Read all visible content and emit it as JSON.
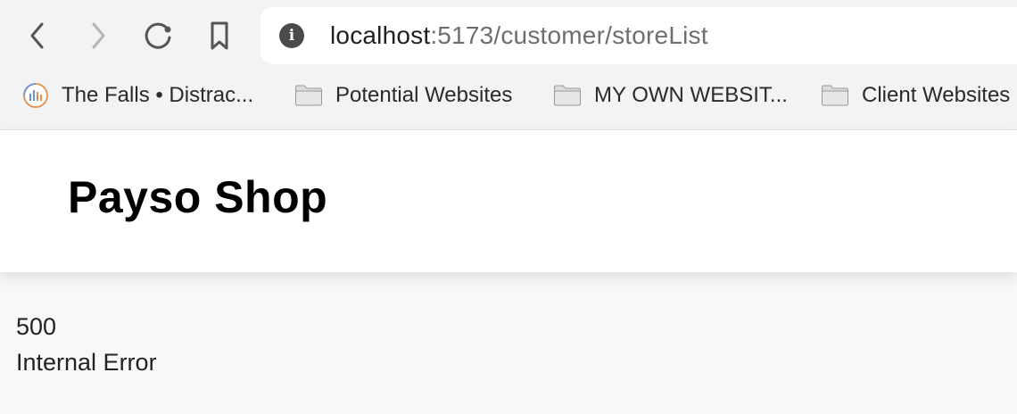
{
  "browser": {
    "url_host": "localhost",
    "url_rest": ":5173/customer/storeList",
    "icons": {
      "back": "chevron-left-icon",
      "forward": "chevron-right-icon",
      "reload": "reload-icon",
      "bookmark": "bookmark-icon",
      "info": "info-icon"
    },
    "info_glyph": "i"
  },
  "bookmarks": [
    {
      "label": "The Falls • Distrac...",
      "icon": "podcast-icon"
    },
    {
      "label": "Potential Websites",
      "icon": "folder-icon"
    },
    {
      "label": "MY OWN WEBSIT...",
      "icon": "folder-icon"
    },
    {
      "label": "Client Websites",
      "icon": "folder-icon"
    }
  ],
  "app": {
    "brand": "Payso Shop"
  },
  "error": {
    "code": "500",
    "message": "Internal Error"
  }
}
